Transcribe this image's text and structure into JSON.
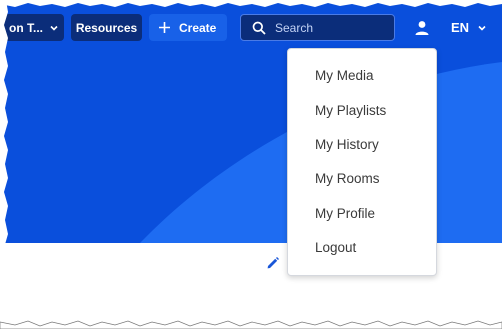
{
  "topbar": {
    "org_label": "on T...",
    "resources_label": "Resources",
    "create_label": "Create",
    "search_placeholder": "Search",
    "language_label": "EN"
  },
  "user_menu": {
    "items": [
      {
        "label": "My Media"
      },
      {
        "label": "My Playlists"
      },
      {
        "label": "My History"
      },
      {
        "label": "My Rooms"
      },
      {
        "label": "My Profile"
      },
      {
        "label": "Logout"
      }
    ]
  },
  "colors": {
    "hero": "#0a4fdc",
    "hero_light": "#1e6cf2",
    "pill_dark": "#0b2d7a",
    "pill_mid": "#1861e8",
    "accent": "#1a57d8"
  },
  "icons": {
    "create": "plus-icon",
    "search": "search-icon",
    "user": "user-icon",
    "edit": "pencil-icon",
    "dropdown": "chevron-down-icon"
  }
}
